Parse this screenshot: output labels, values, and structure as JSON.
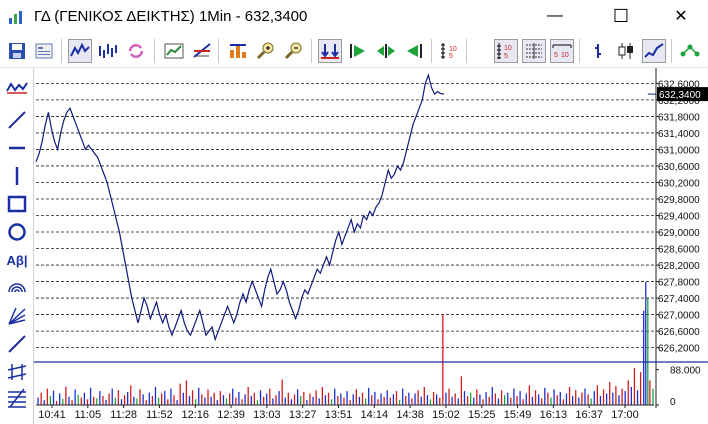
{
  "window": {
    "title": "ΓΔ (ΓΕΝΙΚΟΣ ΔΕΙΚΤΗΣ) 1Min - 632,3400",
    "minimize_glyph": "—",
    "maximize_glyph": "☐",
    "close_glyph": "✕"
  },
  "toolbar": {
    "icons": [
      "save-icon",
      "properties-icon",
      "line-chart-icon",
      "bar-chart-icon",
      "refresh-icon",
      "chart-study-icon",
      "trendline-icon",
      "buy-sell-icon",
      "zoom-in-icon",
      "zoom-out-icon",
      "auto-scale-icon",
      "play-forward-icon",
      "play-center-icon",
      "play-back-icon",
      "scale-icon",
      "values-table-icon",
      "grid-table-icon",
      "numbers-table-icon",
      "tick-chart-icon",
      "candlestick-icon",
      "line-style-icon",
      "network-icon"
    ]
  },
  "left_tools": {
    "icons": [
      "indicator-icon",
      "trend-line-icon",
      "horizontal-line-icon",
      "vertical-line-icon",
      "rectangle-icon",
      "ellipse-icon",
      "text-tool-icon",
      "arc-icon",
      "fan-icon",
      "line-icon",
      "channel-icon",
      "fibonacci-icon"
    ],
    "text_tool_label": "Αβ|"
  },
  "chart_data": {
    "type": "line",
    "title": "",
    "last_value_label": "632,3400",
    "price_ticks": [
      "632,6000",
      "632,2000",
      "631,8000",
      "631,4000",
      "631,0000",
      "630,6000",
      "630,2000",
      "629,8000",
      "629,4000",
      "629,0000",
      "628,6000",
      "628,2000",
      "627,8000",
      "627,4000",
      "627,0000",
      "626,6000",
      "626,2000"
    ],
    "price_range": [
      625.9,
      632.9
    ],
    "volume_ticks": [
      "88.000",
      "0"
    ],
    "volume_max": 102000,
    "time_ticks": [
      "10:41",
      "11:05",
      "11:28",
      "11:52",
      "12:16",
      "12:39",
      "13:03",
      "13:27",
      "13:51",
      "14:14",
      "14:38",
      "15:02",
      "15:25",
      "15:49",
      "16:13",
      "16:37",
      "17:00"
    ],
    "price_series": {
      "name": "",
      "x": [
        0,
        3,
        6,
        9,
        12,
        15,
        18,
        21,
        24,
        27,
        30,
        33,
        36,
        39,
        42,
        45,
        48,
        51,
        54,
        57,
        60,
        63,
        66,
        69,
        72,
        75,
        78,
        81,
        84,
        87,
        90,
        93,
        96,
        99,
        102,
        105,
        108,
        111,
        114,
        117,
        120,
        123,
        126,
        129,
        132,
        135,
        138,
        141,
        144,
        147,
        150,
        153,
        156,
        159,
        162,
        165,
        168,
        171,
        174,
        177,
        180,
        183,
        186,
        189,
        192,
        195,
        198,
        201,
        204,
        207,
        210,
        213,
        216,
        219,
        222,
        225,
        228,
        231,
        234,
        237,
        240,
        243,
        246,
        249,
        252,
        255,
        258,
        261,
        264,
        267,
        270,
        273,
        276,
        279,
        282,
        285,
        288,
        291,
        294,
        297,
        300,
        303,
        306,
        309,
        312,
        315,
        318,
        321,
        324,
        327,
        330,
        333,
        336,
        339,
        342,
        345,
        348,
        351,
        354,
        357,
        360,
        363,
        366,
        369,
        372,
        375,
        378,
        381,
        384,
        387,
        390,
        393,
        396,
        399,
        402,
        405,
        408,
        411,
        414,
        417,
        420,
        423,
        426,
        429,
        432,
        435,
        438,
        441,
        444,
        447,
        450,
        453,
        456,
        459,
        462,
        465,
        468,
        471,
        474,
        477,
        480,
        483,
        486,
        489,
        492,
        495,
        498,
        501,
        504,
        507,
        510,
        513,
        516,
        519,
        522,
        525,
        528,
        531,
        534,
        537,
        540,
        543,
        546,
        549,
        552,
        555,
        558,
        561,
        564,
        567,
        570,
        573,
        576,
        579,
        582,
        585,
        588,
        591,
        594
      ],
      "y": [
        630.7,
        630.9,
        631.2,
        631.6,
        631.9,
        631.5,
        631.2,
        631.0,
        631.4,
        631.7,
        631.9,
        632.0,
        631.8,
        631.6,
        631.4,
        631.2,
        631.0,
        631.1,
        631.0,
        630.9,
        630.8,
        630.6,
        630.4,
        630.2,
        629.9,
        629.6,
        629.3,
        629.0,
        628.6,
        628.2,
        627.8,
        627.4,
        627.1,
        626.8,
        627.1,
        627.4,
        627.2,
        626.9,
        627.1,
        627.3,
        627.0,
        626.8,
        627.0,
        626.7,
        626.5,
        626.7,
        626.9,
        627.1,
        626.8,
        626.6,
        626.5,
        626.7,
        626.9,
        627.1,
        626.8,
        626.5,
        626.6,
        626.7,
        626.4,
        626.6,
        626.8,
        627.0,
        627.2,
        627.0,
        626.8,
        627.0,
        627.3,
        627.5,
        627.3,
        627.6,
        627.8,
        627.6,
        627.4,
        627.2,
        627.6,
        627.9,
        628.1,
        627.8,
        627.5,
        627.6,
        627.8,
        627.6,
        627.3,
        627.1,
        626.9,
        627.1,
        627.4,
        627.6,
        627.5,
        627.7,
        627.9,
        628.1,
        628.0,
        628.2,
        628.4,
        628.2,
        628.5,
        628.8,
        629.0,
        628.7,
        628.9,
        629.1,
        629.3,
        629.0,
        629.2,
        629.1,
        629.4,
        629.3,
        629.5,
        629.4,
        629.6,
        629.7,
        629.9,
        630.2,
        630.5,
        630.3,
        630.4,
        630.6,
        630.5,
        630.7,
        631.0,
        631.3,
        631.6,
        631.8,
        632.0,
        632.2,
        632.6,
        632.8,
        632.5,
        632.34,
        632.4,
        632.35,
        632.34
      ]
    },
    "volume_series": {
      "bars": [
        [
          2,
          18,
          "b"
        ],
        [
          5,
          30,
          "r"
        ],
        [
          8,
          12,
          "b"
        ],
        [
          11,
          40,
          "r"
        ],
        [
          14,
          22,
          "g"
        ],
        [
          17,
          35,
          "b"
        ],
        [
          20,
          10,
          "r"
        ],
        [
          23,
          28,
          "b"
        ],
        [
          26,
          15,
          "g"
        ],
        [
          29,
          45,
          "r"
        ],
        [
          32,
          20,
          "b"
        ],
        [
          35,
          12,
          "r"
        ],
        [
          38,
          38,
          "b"
        ],
        [
          41,
          25,
          "g"
        ],
        [
          44,
          18,
          "r"
        ],
        [
          47,
          30,
          "b"
        ],
        [
          50,
          14,
          "r"
        ],
        [
          53,
          42,
          "b"
        ],
        [
          56,
          20,
          "r"
        ],
        [
          59,
          16,
          "g"
        ],
        [
          62,
          34,
          "b"
        ],
        [
          65,
          22,
          "r"
        ],
        [
          68,
          12,
          "b"
        ],
        [
          71,
          28,
          "r"
        ],
        [
          74,
          40,
          "b"
        ],
        [
          77,
          18,
          "g"
        ],
        [
          80,
          36,
          "r"
        ],
        [
          83,
          14,
          "b"
        ],
        [
          86,
          24,
          "r"
        ],
        [
          89,
          32,
          "b"
        ],
        [
          92,
          48,
          "r"
        ],
        [
          95,
          20,
          "b"
        ],
        [
          98,
          16,
          "g"
        ],
        [
          101,
          38,
          "r"
        ],
        [
          104,
          26,
          "b"
        ],
        [
          107,
          12,
          "r"
        ],
        [
          110,
          30,
          "b"
        ],
        [
          113,
          22,
          "r"
        ],
        [
          116,
          44,
          "b"
        ],
        [
          119,
          18,
          "g"
        ],
        [
          122,
          28,
          "r"
        ],
        [
          125,
          34,
          "b"
        ],
        [
          128,
          14,
          "r"
        ],
        [
          131,
          40,
          "b"
        ],
        [
          134,
          24,
          "r"
        ],
        [
          137,
          12,
          "b"
        ],
        [
          140,
          52,
          "r"
        ],
        [
          143,
          30,
          "b"
        ],
        [
          146,
          60,
          "r"
        ],
        [
          149,
          22,
          "b"
        ],
        [
          152,
          36,
          "r"
        ],
        [
          155,
          14,
          "g"
        ],
        [
          158,
          42,
          "b"
        ],
        [
          161,
          26,
          "r"
        ],
        [
          164,
          18,
          "b"
        ],
        [
          167,
          38,
          "r"
        ],
        [
          170,
          20,
          "b"
        ],
        [
          173,
          30,
          "r"
        ],
        [
          176,
          12,
          "b"
        ],
        [
          179,
          34,
          "r"
        ],
        [
          182,
          24,
          "b"
        ],
        [
          185,
          16,
          "g"
        ],
        [
          188,
          28,
          "r"
        ],
        [
          191,
          40,
          "b"
        ],
        [
          194,
          18,
          "r"
        ],
        [
          197,
          32,
          "b"
        ],
        [
          200,
          14,
          "r"
        ],
        [
          203,
          26,
          "b"
        ],
        [
          206,
          44,
          "r"
        ],
        [
          209,
          22,
          "b"
        ],
        [
          212,
          30,
          "r"
        ],
        [
          215,
          12,
          "g"
        ],
        [
          218,
          36,
          "b"
        ],
        [
          221,
          20,
          "r"
        ],
        [
          224,
          28,
          "b"
        ],
        [
          227,
          40,
          "r"
        ],
        [
          230,
          16,
          "b"
        ],
        [
          233,
          24,
          "r"
        ],
        [
          236,
          34,
          "b"
        ],
        [
          239,
          62,
          "r"
        ],
        [
          242,
          18,
          "b"
        ],
        [
          245,
          30,
          "r"
        ],
        [
          248,
          14,
          "b"
        ],
        [
          251,
          26,
          "r"
        ],
        [
          254,
          38,
          "b"
        ],
        [
          257,
          22,
          "g"
        ],
        [
          260,
          32,
          "r"
        ],
        [
          263,
          12,
          "b"
        ],
        [
          266,
          28,
          "r"
        ],
        [
          269,
          20,
          "b"
        ],
        [
          272,
          36,
          "r"
        ],
        [
          275,
          16,
          "b"
        ],
        [
          278,
          44,
          "r"
        ],
        [
          281,
          24,
          "b"
        ],
        [
          284,
          30,
          "r"
        ],
        [
          287,
          14,
          "g"
        ],
        [
          290,
          40,
          "b"
        ],
        [
          293,
          22,
          "r"
        ],
        [
          296,
          28,
          "b"
        ],
        [
          299,
          18,
          "r"
        ],
        [
          302,
          34,
          "b"
        ],
        [
          305,
          12,
          "r"
        ],
        [
          308,
          26,
          "b"
        ],
        [
          311,
          38,
          "r"
        ],
        [
          314,
          20,
          "b"
        ],
        [
          317,
          30,
          "r"
        ],
        [
          320,
          16,
          "g"
        ],
        [
          323,
          42,
          "b"
        ],
        [
          326,
          24,
          "r"
        ],
        [
          329,
          32,
          "b"
        ],
        [
          332,
          14,
          "r"
        ],
        [
          335,
          28,
          "b"
        ],
        [
          338,
          20,
          "r"
        ],
        [
          341,
          36,
          "b"
        ],
        [
          344,
          18,
          "r"
        ],
        [
          347,
          26,
          "b"
        ],
        [
          350,
          34,
          "r"
        ],
        [
          353,
          12,
          "g"
        ],
        [
          356,
          40,
          "b"
        ],
        [
          359,
          22,
          "r"
        ],
        [
          362,
          30,
          "b"
        ],
        [
          365,
          16,
          "r"
        ],
        [
          368,
          28,
          "b"
        ],
        [
          371,
          36,
          "r"
        ],
        [
          374,
          20,
          "b"
        ],
        [
          377,
          44,
          "r"
        ],
        [
          380,
          24,
          "b"
        ],
        [
          383,
          14,
          "g"
        ],
        [
          386,
          32,
          "r"
        ],
        [
          389,
          26,
          "b"
        ],
        [
          392,
          18,
          "r"
        ],
        [
          395,
          220,
          "r"
        ],
        [
          398,
          30,
          "b"
        ],
        [
          401,
          40,
          "r"
        ],
        [
          404,
          20,
          "b"
        ],
        [
          407,
          28,
          "r"
        ],
        [
          410,
          16,
          "b"
        ],
        [
          413,
          70,
          "r"
        ],
        [
          416,
          34,
          "b"
        ],
        [
          419,
          22,
          "r"
        ],
        [
          422,
          30,
          "g"
        ],
        [
          425,
          18,
          "b"
        ],
        [
          428,
          38,
          "r"
        ],
        [
          431,
          26,
          "b"
        ],
        [
          434,
          14,
          "r"
        ],
        [
          437,
          32,
          "b"
        ],
        [
          440,
          20,
          "r"
        ],
        [
          443,
          44,
          "b"
        ],
        [
          446,
          28,
          "r"
        ],
        [
          449,
          16,
          "b"
        ],
        [
          452,
          36,
          "r"
        ],
        [
          455,
          24,
          "g"
        ],
        [
          458,
          30,
          "b"
        ],
        [
          461,
          18,
          "r"
        ],
        [
          464,
          40,
          "b"
        ],
        [
          467,
          22,
          "r"
        ],
        [
          470,
          34,
          "b"
        ],
        [
          473,
          14,
          "r"
        ],
        [
          476,
          28,
          "b"
        ],
        [
          479,
          48,
          "r"
        ],
        [
          482,
          20,
          "b"
        ],
        [
          485,
          36,
          "r"
        ],
        [
          488,
          26,
          "b"
        ],
        [
          491,
          16,
          "r"
        ],
        [
          494,
          42,
          "b"
        ],
        [
          497,
          30,
          "r"
        ],
        [
          500,
          18,
          "g"
        ],
        [
          503,
          38,
          "b"
        ],
        [
          506,
          24,
          "r"
        ],
        [
          509,
          32,
          "b"
        ],
        [
          512,
          14,
          "r"
        ],
        [
          515,
          28,
          "b"
        ],
        [
          518,
          44,
          "r"
        ],
        [
          521,
          22,
          "b"
        ],
        [
          524,
          36,
          "r"
        ],
        [
          527,
          18,
          "b"
        ],
        [
          530,
          30,
          "r"
        ],
        [
          533,
          40,
          "b"
        ],
        [
          536,
          26,
          "r"
        ],
        [
          539,
          16,
          "g"
        ],
        [
          542,
          34,
          "b"
        ],
        [
          545,
          48,
          "r"
        ],
        [
          548,
          22,
          "b"
        ],
        [
          551,
          38,
          "r"
        ],
        [
          554,
          28,
          "b"
        ],
        [
          557,
          56,
          "r"
        ],
        [
          560,
          30,
          "b"
        ],
        [
          563,
          46,
          "r"
        ],
        [
          566,
          24,
          "b"
        ],
        [
          569,
          40,
          "r"
        ],
        [
          572,
          34,
          "b"
        ],
        [
          575,
          60,
          "r"
        ],
        [
          578,
          44,
          "b"
        ],
        [
          581,
          90,
          "r"
        ],
        [
          584,
          36,
          "b"
        ],
        [
          587,
          80,
          "r"
        ],
        [
          590,
          230,
          "b"
        ],
        [
          592,
          300,
          "b"
        ],
        [
          594,
          260,
          "g"
        ],
        [
          596,
          60,
          "r"
        ],
        [
          599,
          40,
          "g"
        ]
      ]
    }
  }
}
